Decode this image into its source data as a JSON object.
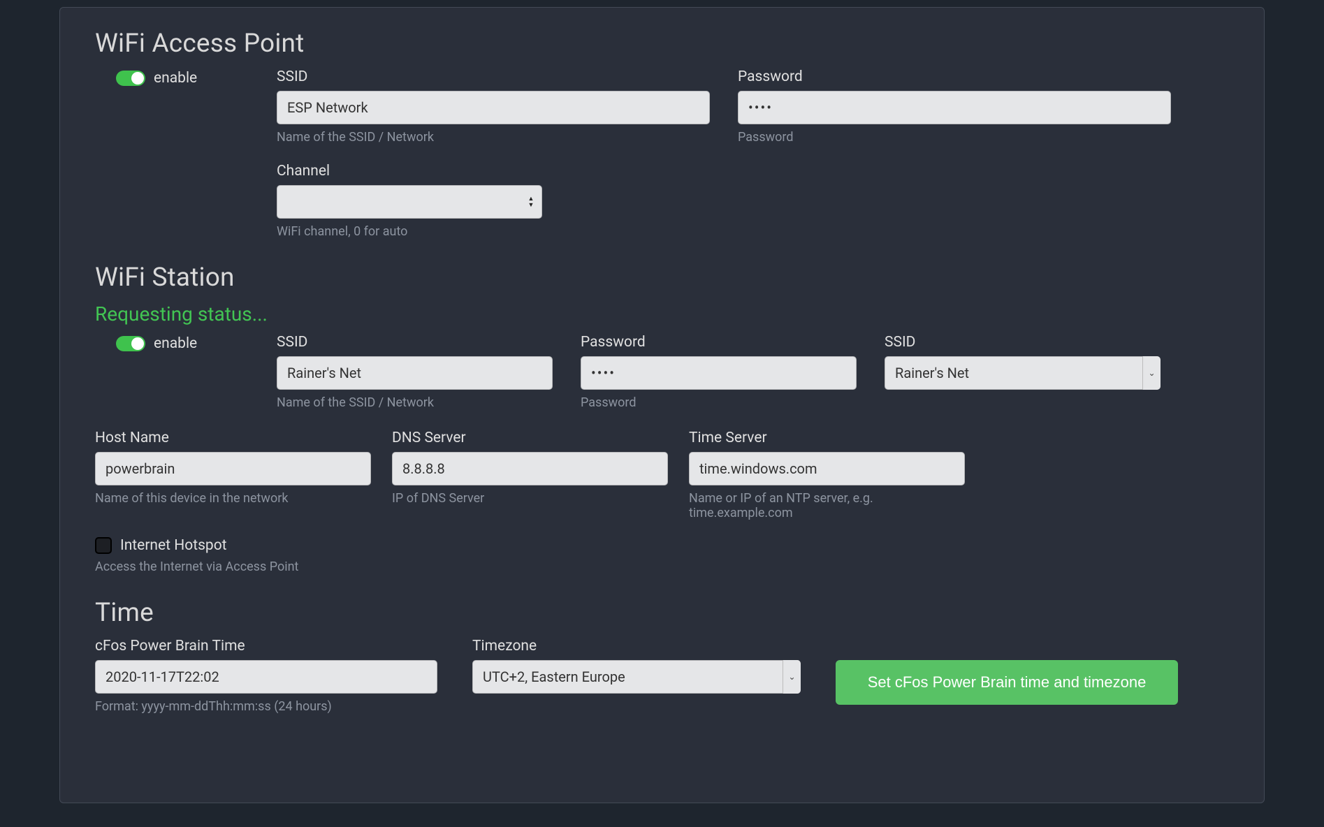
{
  "ap": {
    "title": "WiFi Access Point",
    "enable_label": "enable",
    "ssid_label": "SSID",
    "ssid_value": "ESP Network",
    "ssid_help": "Name of the SSID / Network",
    "pw_label": "Password",
    "pw_value": "••••",
    "pw_help": "Password",
    "channel_label": "Channel",
    "channel_value": "",
    "channel_help": "WiFi channel, 0 for auto"
  },
  "station": {
    "title": "WiFi Station",
    "status": "Requesting status...",
    "enable_label": "enable",
    "ssid_label": "SSID",
    "ssid_value": "Rainer's Net",
    "ssid_help": "Name of the SSID / Network",
    "pw_label": "Password",
    "pw_value": "••••",
    "pw_help": "Password",
    "ssid_select_label": "SSID",
    "ssid_select_value": "Rainer's Net",
    "host_label": "Host Name",
    "host_value": "powerbrain",
    "host_help": "Name of this device in the network",
    "dns_label": "DNS Server",
    "dns_value": "8.8.8.8",
    "dns_help": "IP of DNS Server",
    "time_label": "Time Server",
    "time_value": "time.windows.com",
    "time_help": "Name or IP of an NTP server, e.g. time.example.com",
    "hotspot_label": "Internet Hotspot",
    "hotspot_help": "Access the Internet via Access Point"
  },
  "time": {
    "title": "Time",
    "brain_label": "cFos Power Brain Time",
    "brain_value": "2020-11-17T22:02",
    "brain_help": "Format: yyyy-mm-ddThh:mm:ss (24 hours)",
    "tz_label": "Timezone",
    "tz_value": "UTC+2, Eastern Europe",
    "button_label": "Set cFos Power Brain time and timezone"
  }
}
